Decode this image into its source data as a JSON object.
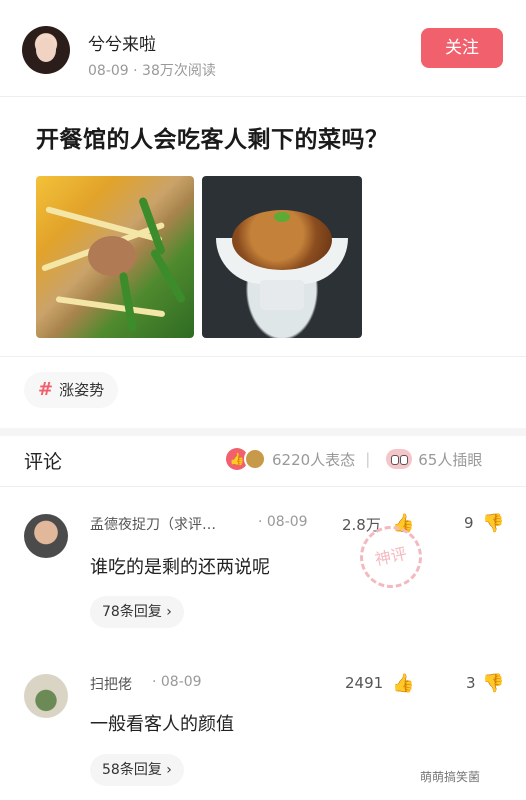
{
  "header": {
    "author_name": "兮兮来啦",
    "meta": "08-09 · 38万次阅读",
    "follow_label": "关注"
  },
  "post": {
    "title": "开餐馆的人会吃客人剩下的菜吗？",
    "tag": "涨姿势",
    "tag_icon": "#"
  },
  "comments_header": {
    "title": "评论",
    "reaction_count": "6220人表态",
    "separator": "|",
    "eye_count": "65人插眼"
  },
  "comments": [
    {
      "name": "孟德夜捉刀（求评…",
      "time": "· 08-09",
      "likes": "2.8万",
      "dislikes": "9",
      "text": "谁吃的是剩的还两说呢",
      "replies": "78条回复 ›",
      "badge": "神评"
    },
    {
      "name": "扫把佬",
      "time": "· 08-09",
      "likes": "2491",
      "dislikes": "3",
      "text": "一般看客人的颜值",
      "replies": "58条回复 ›"
    }
  ],
  "watermark": "萌萌搞笑菌",
  "colors": {
    "accent": "#f1606d",
    "tag_bg": "#f7f7f7",
    "muted": "#999999"
  }
}
